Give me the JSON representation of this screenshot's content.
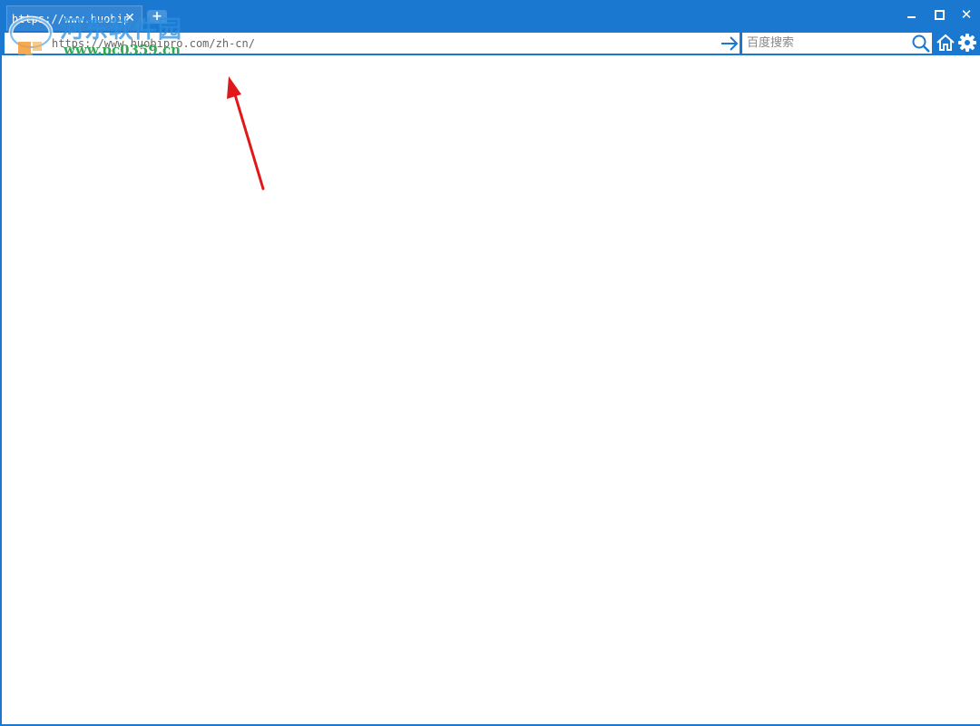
{
  "tab": {
    "title": "https://www.huobip",
    "close_glyph": "✕"
  },
  "new_tab": {
    "glyph": "+"
  },
  "window_controls": {
    "close_glyph": "✕"
  },
  "address_bar": {
    "value": "https://www.huobipro.com/zh-cn/"
  },
  "search": {
    "placeholder": "百度搜索"
  },
  "watermark": {
    "brand": "河东软件园",
    "url": "www.pc0359.cn"
  },
  "icons": {
    "go": "arrow-right-icon",
    "search": "search-icon",
    "home": "home-icon",
    "settings": "gear-icon"
  },
  "colors": {
    "chrome": "#1a78d0",
    "annotation_arrow": "#e0181b",
    "watermark_brand": "#2b8fe0",
    "watermark_url": "#34a853"
  }
}
